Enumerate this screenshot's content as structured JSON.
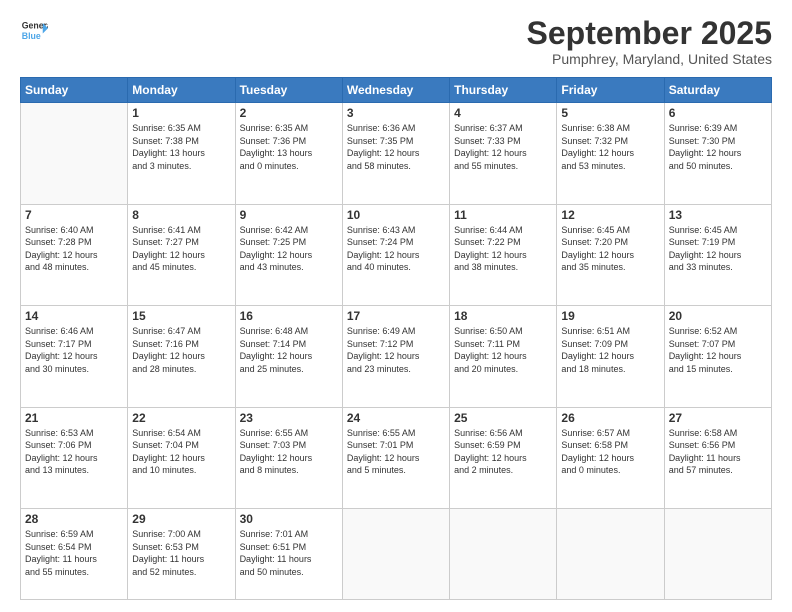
{
  "header": {
    "logo_line1": "General",
    "logo_line2": "Blue",
    "month": "September 2025",
    "location": "Pumphrey, Maryland, United States"
  },
  "weekdays": [
    "Sunday",
    "Monday",
    "Tuesday",
    "Wednesday",
    "Thursday",
    "Friday",
    "Saturday"
  ],
  "weeks": [
    [
      {
        "day": "",
        "text": ""
      },
      {
        "day": "1",
        "text": "Sunrise: 6:35 AM\nSunset: 7:38 PM\nDaylight: 13 hours\nand 3 minutes."
      },
      {
        "day": "2",
        "text": "Sunrise: 6:35 AM\nSunset: 7:36 PM\nDaylight: 13 hours\nand 0 minutes."
      },
      {
        "day": "3",
        "text": "Sunrise: 6:36 AM\nSunset: 7:35 PM\nDaylight: 12 hours\nand 58 minutes."
      },
      {
        "day": "4",
        "text": "Sunrise: 6:37 AM\nSunset: 7:33 PM\nDaylight: 12 hours\nand 55 minutes."
      },
      {
        "day": "5",
        "text": "Sunrise: 6:38 AM\nSunset: 7:32 PM\nDaylight: 12 hours\nand 53 minutes."
      },
      {
        "day": "6",
        "text": "Sunrise: 6:39 AM\nSunset: 7:30 PM\nDaylight: 12 hours\nand 50 minutes."
      }
    ],
    [
      {
        "day": "7",
        "text": "Sunrise: 6:40 AM\nSunset: 7:28 PM\nDaylight: 12 hours\nand 48 minutes."
      },
      {
        "day": "8",
        "text": "Sunrise: 6:41 AM\nSunset: 7:27 PM\nDaylight: 12 hours\nand 45 minutes."
      },
      {
        "day": "9",
        "text": "Sunrise: 6:42 AM\nSunset: 7:25 PM\nDaylight: 12 hours\nand 43 minutes."
      },
      {
        "day": "10",
        "text": "Sunrise: 6:43 AM\nSunset: 7:24 PM\nDaylight: 12 hours\nand 40 minutes."
      },
      {
        "day": "11",
        "text": "Sunrise: 6:44 AM\nSunset: 7:22 PM\nDaylight: 12 hours\nand 38 minutes."
      },
      {
        "day": "12",
        "text": "Sunrise: 6:45 AM\nSunset: 7:20 PM\nDaylight: 12 hours\nand 35 minutes."
      },
      {
        "day": "13",
        "text": "Sunrise: 6:45 AM\nSunset: 7:19 PM\nDaylight: 12 hours\nand 33 minutes."
      }
    ],
    [
      {
        "day": "14",
        "text": "Sunrise: 6:46 AM\nSunset: 7:17 PM\nDaylight: 12 hours\nand 30 minutes."
      },
      {
        "day": "15",
        "text": "Sunrise: 6:47 AM\nSunset: 7:16 PM\nDaylight: 12 hours\nand 28 minutes."
      },
      {
        "day": "16",
        "text": "Sunrise: 6:48 AM\nSunset: 7:14 PM\nDaylight: 12 hours\nand 25 minutes."
      },
      {
        "day": "17",
        "text": "Sunrise: 6:49 AM\nSunset: 7:12 PM\nDaylight: 12 hours\nand 23 minutes."
      },
      {
        "day": "18",
        "text": "Sunrise: 6:50 AM\nSunset: 7:11 PM\nDaylight: 12 hours\nand 20 minutes."
      },
      {
        "day": "19",
        "text": "Sunrise: 6:51 AM\nSunset: 7:09 PM\nDaylight: 12 hours\nand 18 minutes."
      },
      {
        "day": "20",
        "text": "Sunrise: 6:52 AM\nSunset: 7:07 PM\nDaylight: 12 hours\nand 15 minutes."
      }
    ],
    [
      {
        "day": "21",
        "text": "Sunrise: 6:53 AM\nSunset: 7:06 PM\nDaylight: 12 hours\nand 13 minutes."
      },
      {
        "day": "22",
        "text": "Sunrise: 6:54 AM\nSunset: 7:04 PM\nDaylight: 12 hours\nand 10 minutes."
      },
      {
        "day": "23",
        "text": "Sunrise: 6:55 AM\nSunset: 7:03 PM\nDaylight: 12 hours\nand 8 minutes."
      },
      {
        "day": "24",
        "text": "Sunrise: 6:55 AM\nSunset: 7:01 PM\nDaylight: 12 hours\nand 5 minutes."
      },
      {
        "day": "25",
        "text": "Sunrise: 6:56 AM\nSunset: 6:59 PM\nDaylight: 12 hours\nand 2 minutes."
      },
      {
        "day": "26",
        "text": "Sunrise: 6:57 AM\nSunset: 6:58 PM\nDaylight: 12 hours\nand 0 minutes."
      },
      {
        "day": "27",
        "text": "Sunrise: 6:58 AM\nSunset: 6:56 PM\nDaylight: 11 hours\nand 57 minutes."
      }
    ],
    [
      {
        "day": "28",
        "text": "Sunrise: 6:59 AM\nSunset: 6:54 PM\nDaylight: 11 hours\nand 55 minutes."
      },
      {
        "day": "29",
        "text": "Sunrise: 7:00 AM\nSunset: 6:53 PM\nDaylight: 11 hours\nand 52 minutes."
      },
      {
        "day": "30",
        "text": "Sunrise: 7:01 AM\nSunset: 6:51 PM\nDaylight: 11 hours\nand 50 minutes."
      },
      {
        "day": "",
        "text": ""
      },
      {
        "day": "",
        "text": ""
      },
      {
        "day": "",
        "text": ""
      },
      {
        "day": "",
        "text": ""
      }
    ]
  ]
}
